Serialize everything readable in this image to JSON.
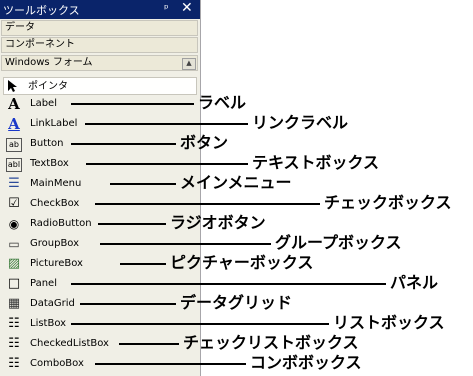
{
  "window": {
    "title": "ツールボックス",
    "pin_icon": "ᵖ",
    "close_icon": "✕"
  },
  "tabs": [
    "データ",
    "コンポーネント",
    "Windows フォーム"
  ],
  "scroll_icon": "▲",
  "pointer_label": "ポインタ",
  "tools": [
    {
      "label": "Label",
      "icon": "A",
      "annotation": "ラベル"
    },
    {
      "label": "LinkLabel",
      "icon": "A",
      "annotation": "リンクラベル"
    },
    {
      "label": "Button",
      "icon": "ab",
      "annotation": "ボタン"
    },
    {
      "label": "TextBox",
      "icon": "abl",
      "annotation": "テキストボックス"
    },
    {
      "label": "MainMenu",
      "icon": "☰",
      "annotation": "メインメニュー"
    },
    {
      "label": "CheckBox",
      "icon": "☑",
      "annotation": "チェックボックス"
    },
    {
      "label": "RadioButton",
      "icon": "◉",
      "annotation": "ラジオボタン"
    },
    {
      "label": "GroupBox",
      "icon": "▭",
      "annotation": "グループボックス"
    },
    {
      "label": "PictureBox",
      "icon": "▨",
      "annotation": "ピクチャーボックス"
    },
    {
      "label": "Panel",
      "icon": "□",
      "annotation": "パネル"
    },
    {
      "label": "DataGrid",
      "icon": "▦",
      "annotation": "データグリッド"
    },
    {
      "label": "ListBox",
      "icon": "☷",
      "annotation": "リストボックス"
    },
    {
      "label": "CheckedListBox",
      "icon": "☷",
      "annotation": "チェックリストボックス"
    },
    {
      "label": "ComboBox",
      "icon": "☷",
      "annotation": "コンボボックス"
    }
  ],
  "colors": {
    "titlebar": "#0a246a",
    "panel": "#f0efe6"
  }
}
